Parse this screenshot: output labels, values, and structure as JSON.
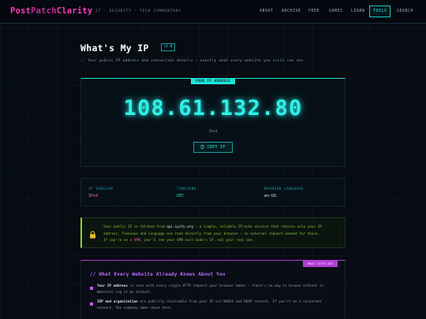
{
  "nav": {
    "logo_part1": "Post",
    "logo_part2": "Patch",
    "logo_part3": "Clarity",
    "tagline": "IT · SECURITY · TECH COMMENTARY",
    "items": [
      {
        "label": "ABOUT",
        "active": false
      },
      {
        "label": "ARCHIVE",
        "active": false
      },
      {
        "label": "FEED",
        "active": false
      },
      {
        "label": "GAMES",
        "active": false
      },
      {
        "label": "LEARN",
        "active": false
      },
      {
        "label": "TOOLS",
        "active": true
      },
      {
        "label": "SEARCH",
        "active": false
      }
    ]
  },
  "header": {
    "title": "What's My IP",
    "version": "v1.0",
    "subtitle_prefix": "//",
    "subtitle": "Your public IP address and connection details — exactly what every website you visit can see"
  },
  "ip_card": {
    "tag": "YOUR IP ADDRESS",
    "ip": "108.61.132.80",
    "ip_version": "IPv4",
    "copy_label": "COPY IP",
    "copy_icon": "clipboard-icon"
  },
  "info": {
    "ip_version_label": "IP VERSION",
    "ip_version_value": "IPv4",
    "timezone_label": "TIMEZONE",
    "timezone_value": "UTC",
    "language_label": "BROWSER LANGUAGE",
    "language_value": "en-US"
  },
  "notice": {
    "icon": "lock-icon",
    "t1": "Your public IP is fetched from ",
    "t2": "api.ipify.org",
    "t3": " — a simple, reliable IP-echo service that returns only your IP",
    "t4": "address. Timezone and language are read directly from your browser — no external request needed for those.",
    "t5": "If you're on a ",
    "t6": "VPN",
    "t7": ", you'll see your VPN exit node's IP, not your real one."
  },
  "section": {
    "tag": "WHAT SITES SEE",
    "title": "// What Every Website Already Knows About You",
    "item1_bold": "Your IP address",
    "item1_rest": " is sent with every single HTTP request your browser makes — there's no way to browse without it.",
    "item1_line2": "Websites log it by default.",
    "item2_bold": "ISP and organization",
    "item2_rest": " are publicly resolvable from your IP via WHOIS and RDAP records.  If you're on a corporate",
    "item2_line2": "network, the company name shows here."
  },
  "colors": {
    "accent_teal": "#2ff2ea",
    "accent_pink": "#ff3dbb",
    "accent_purple": "#b13dd6",
    "notice_green": "#8ac23c",
    "background": "#070b12"
  }
}
